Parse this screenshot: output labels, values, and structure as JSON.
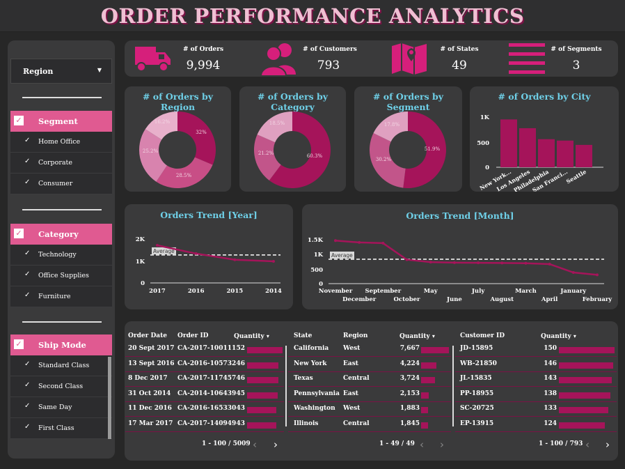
{
  "title": "ORDER PERFORMANCE ANALYTICS",
  "colors": {
    "accent": "#e05a91",
    "bar": "#a5145a",
    "teal": "#6fd0e8",
    "panel": "#3a3a3b"
  },
  "filters": {
    "region_label": "Region",
    "segment": {
      "label": "Segment",
      "items": [
        "Home Office",
        "Corporate",
        "Consumer"
      ]
    },
    "category": {
      "label": "Category",
      "items": [
        "Technology",
        "Office Supplies",
        "Furniture"
      ]
    },
    "ship_mode": {
      "label": "Ship Mode",
      "items": [
        "Standard Class",
        "Second Class",
        "Same Day",
        "First Class"
      ]
    }
  },
  "kpis": [
    {
      "label": "# of Orders",
      "value": "9,994",
      "icon": "truck-icon"
    },
    {
      "label": "# of Customers",
      "value": "793",
      "icon": "users-icon"
    },
    {
      "label": "# of States",
      "value": "49",
      "icon": "map-pin-icon"
    },
    {
      "label": "# of Segments",
      "value": "3",
      "icon": "list-lines-icon"
    }
  ],
  "chart_data": [
    {
      "type": "pie",
      "title": "# of Orders by Region",
      "values": [
        32,
        28.5,
        25.2,
        16.2
      ],
      "labels": [
        "32%",
        "28.5%",
        "25.2%",
        "16.2%"
      ]
    },
    {
      "type": "pie",
      "title": "# of Orders by Category",
      "values": [
        60.3,
        21.2,
        18.5
      ],
      "labels": [
        "60.3%",
        "21.2%",
        "18.5%"
      ]
    },
    {
      "type": "pie",
      "title": "# of Orders by Segment",
      "values": [
        51.9,
        30.2,
        17.8
      ],
      "labels": [
        "51.9%",
        "30.2%",
        "17.8%"
      ]
    },
    {
      "type": "bar",
      "title": "# of Orders by City",
      "categories": [
        "New York...",
        "Los Angeles",
        "Philadelphia",
        "San Franci...",
        "Seattle"
      ],
      "values": [
        915,
        747,
        537,
        510,
        428
      ],
      "yticks": [
        "1K",
        "500",
        "0"
      ],
      "ylim": [
        0,
        1000
      ]
    },
    {
      "type": "line",
      "title": "Orders Trend [Year]",
      "categories": [
        "2017",
        "2016",
        "2015",
        "2014"
      ],
      "values": [
        1687,
        1315,
        1038,
        969
      ],
      "average": 1252,
      "average_label": "Average",
      "yticks": [
        "2K",
        "1K",
        "0"
      ],
      "ylim": [
        0,
        2000
      ]
    },
    {
      "type": "line",
      "title": "Orders Trend [Month]",
      "categories": [
        "November",
        "December",
        "September",
        "October",
        "May",
        "June",
        "July",
        "August",
        "March",
        "April",
        "January",
        "February"
      ],
      "values": [
        1470,
        1408,
        1383,
        819,
        735,
        717,
        710,
        706,
        696,
        668,
        381,
        300
      ],
      "average": 833,
      "average_label": "Average",
      "yticks": [
        "1.5K",
        "1K",
        "500",
        "0"
      ],
      "ylim": [
        0,
        1500
      ]
    }
  ],
  "table1": {
    "headers": [
      "Order Date",
      "Order ID",
      "Quantity"
    ],
    "rows": [
      [
        "20 Sept 2017",
        "CA-2017-100111",
        "52"
      ],
      [
        "13 Sept 2016",
        "CA-2016-105732",
        "46"
      ],
      [
        "8 Dec 2017",
        "CA-2017-117457",
        "46"
      ],
      [
        "31 Oct 2014",
        "CA-2014-106439",
        "45"
      ],
      [
        "11 Dec 2016",
        "CA-2016-165330",
        "43"
      ],
      [
        "17 Mar 2017",
        "CA-2017-140949",
        "43"
      ]
    ],
    "bar_fracs": [
      1.0,
      0.88,
      0.88,
      0.87,
      0.83,
      0.83
    ],
    "pagination": "1 - 100 / 5009"
  },
  "table2": {
    "headers": [
      "State",
      "Region",
      "Quantity"
    ],
    "rows": [
      [
        "California",
        "West",
        "7,667"
      ],
      [
        "New York",
        "East",
        "4,224"
      ],
      [
        "Texas",
        "Central",
        "3,724"
      ],
      [
        "Pennsylvania",
        "East",
        "2,153"
      ],
      [
        "Washington",
        "West",
        "1,883"
      ],
      [
        "Illinois",
        "Central",
        "1,845"
      ]
    ],
    "bar_fracs": [
      1.0,
      0.55,
      0.49,
      0.28,
      0.25,
      0.24
    ],
    "pagination": "1 - 49 / 49"
  },
  "table3": {
    "headers": [
      "Customer ID",
      "Quantity"
    ],
    "rows": [
      [
        "JD-15895",
        "150"
      ],
      [
        "WB-21850",
        "146"
      ],
      [
        "JL-15835",
        "143"
      ],
      [
        "PP-18955",
        "138"
      ],
      [
        "SC-20725",
        "133"
      ],
      [
        "EP-13915",
        "124"
      ]
    ],
    "bar_fracs": [
      1.0,
      0.97,
      0.95,
      0.92,
      0.89,
      0.83
    ],
    "pagination": "1 - 100 / 793"
  },
  "sort_arrow": "▾"
}
